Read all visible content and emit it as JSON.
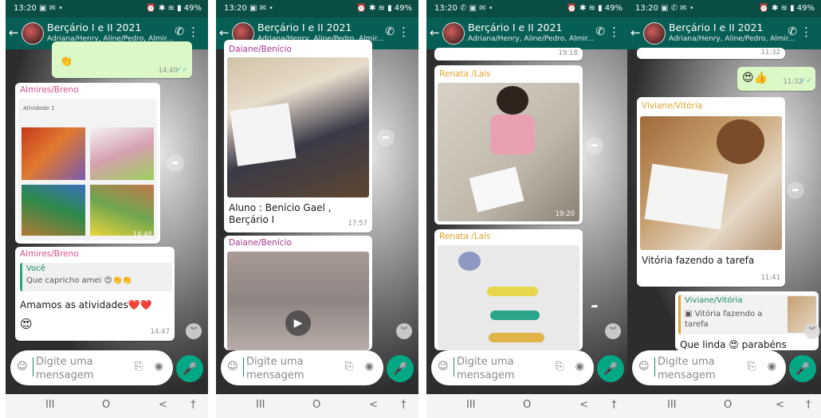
{
  "header": {
    "time": "13:20",
    "status_right": "49%",
    "title": "Berçário I e II 2021",
    "subtitle": "Adriana/Henry, Aline/Pedro, Almir..."
  },
  "input": {
    "placeholder": "Digite uma mensagem"
  },
  "nav": {
    "recents": "III",
    "home": "O",
    "back": "<",
    "accessibility": "†"
  },
  "screen1": {
    "top_ts": "14:40",
    "sender1": "Almires/Breno",
    "doc_heading": "Atividade 1",
    "img1_ts": "14:46",
    "sender2": "Almires/Breno",
    "quote_author": "Você",
    "quote_text": "Que capricho amei 😍👏👏",
    "message": "Amamos as atividades❤️❤️",
    "message_emoji": "😍",
    "msg_ts": "14:47"
  },
  "screen2": {
    "sender1": "Daiane/Benício",
    "caption": "Aluno : Benício Gael , Berçário I",
    "caption_ts": "17:57",
    "sender2": "Daiane/Benício"
  },
  "screen3": {
    "top_ts": "19:18",
    "sender1": "Renata /Laís",
    "img1_ts": "19:20",
    "sender2": "Renata /Laís"
  },
  "screen4": {
    "top_ts": "11:32",
    "out_msg": "😍👍",
    "out_ts": "11:32",
    "sender1": "Viviane/Vitória",
    "caption": "Vitória fazendo a tarefa",
    "caption_ts": "11:41",
    "reply_author": "Viviane/Vitória",
    "reply_quote": "Vitória fazendo a tarefa",
    "reply_text": "Que linda 😍 parabéns"
  }
}
